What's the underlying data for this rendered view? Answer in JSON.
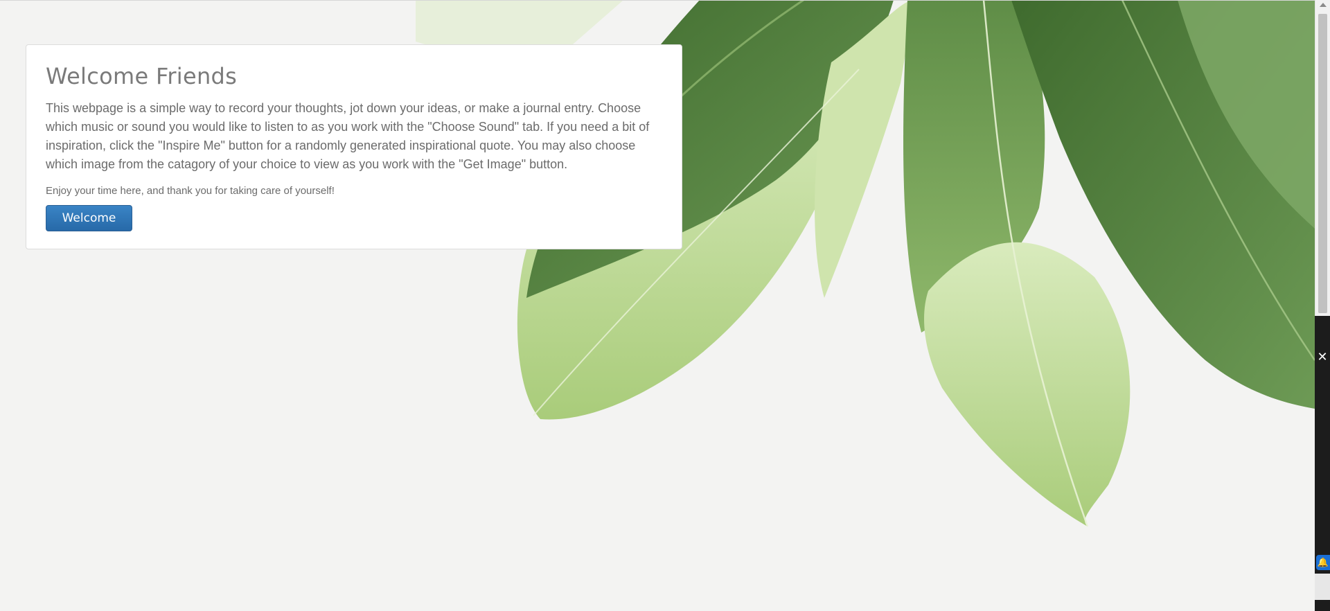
{
  "jumbotron": {
    "title": "Welcome Friends",
    "intro": "This webpage is a simple way to record your thoughts, jot down your ideas, or make a journal entry. Choose which music or sound you would like to listen to as you work with the \"Choose Sound\" tab. If you need a bit of inspiration, click the \"Inspire Me\" button for a randomly generated inspirational quote. You may also choose which image from the catagory of your choice to view as you work with the \"Get Image\" button.",
    "thanks": "Enjoy your time here, and thank you for taking care of yourself!",
    "button_label": "Welcome"
  },
  "side_panel": {
    "close_icon": "close-icon",
    "bell_icon": "bell-icon"
  },
  "colors": {
    "background": "#f3f3f2",
    "button": "#2d6fae",
    "leaf_dark": "#4e7d3c",
    "leaf_light": "#c6dfa3"
  }
}
